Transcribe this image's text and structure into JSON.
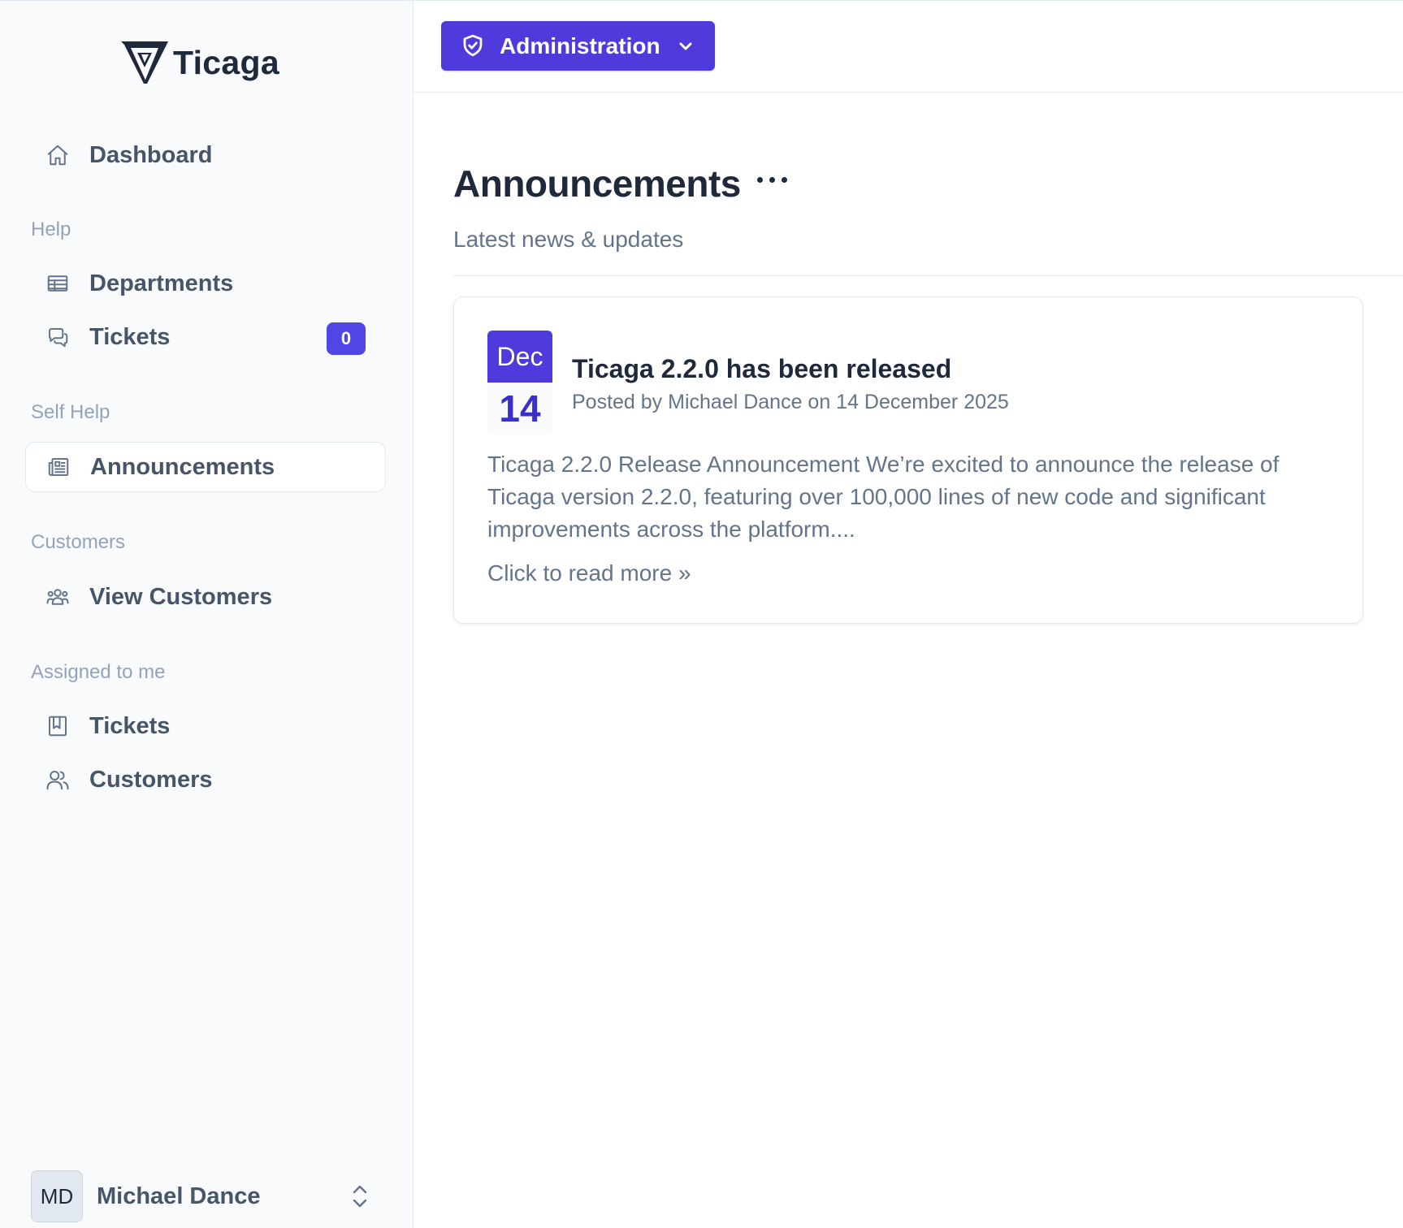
{
  "brand": {
    "name": "Ticaga",
    "accent": "#4f46e5"
  },
  "sidebar": {
    "dashboard": {
      "label": "Dashboard",
      "icon": "home-icon"
    },
    "sections": [
      {
        "title": "Help"
      },
      {
        "title": "Self Help"
      },
      {
        "title": "Customers"
      },
      {
        "title": "Assigned to me"
      }
    ],
    "help_items": [
      {
        "label": "Departments",
        "icon": "table-icon"
      },
      {
        "label": "Tickets",
        "icon": "chat-icon",
        "badge": "0"
      }
    ],
    "self_help_items": [
      {
        "label": "Announcements",
        "icon": "newspaper-icon",
        "active": true
      }
    ],
    "customer_items": [
      {
        "label": "View Customers",
        "icon": "user-group-icon"
      }
    ],
    "assigned_items": [
      {
        "label": "Tickets",
        "icon": "book-icon"
      },
      {
        "label": "Customers",
        "icon": "users-icon"
      }
    ],
    "user": {
      "initials": "MD",
      "name": "Michael Dance"
    }
  },
  "topbar": {
    "admin_label": "Administration"
  },
  "main": {
    "title": "Announcements",
    "subtitle": "Latest news & updates",
    "announcements": [
      {
        "month": "Dec",
        "day": "14",
        "title": "Ticaga 2.2.0 has been released",
        "meta": "Posted by Michael Dance on 14 December 2025",
        "body": "Ticaga 2.2.0 Release Announcement We’re excited to announce the release of Ticaga version 2.2.0, featuring over 100,000 lines of new code and significant improvements across the platform....",
        "read_more": "Click to read more »"
      }
    ]
  }
}
